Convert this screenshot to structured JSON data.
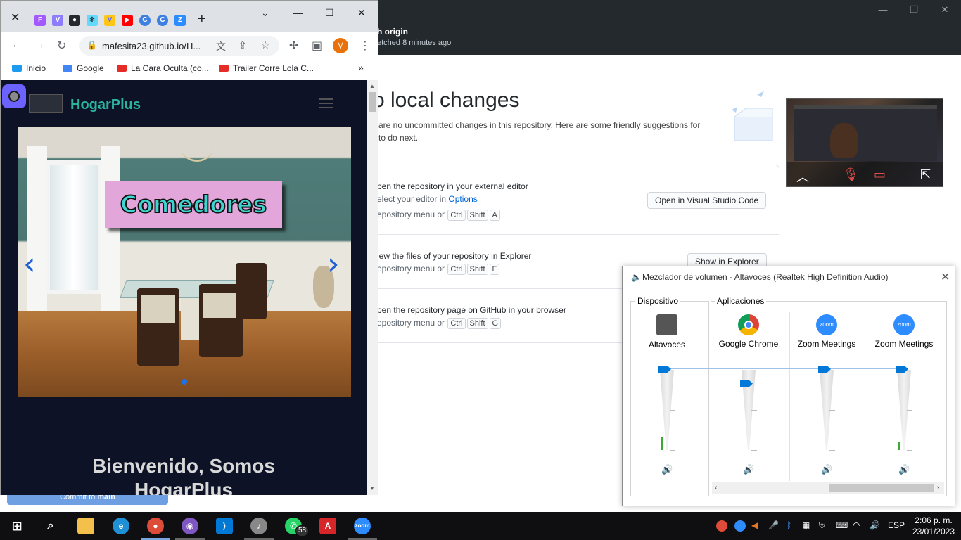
{
  "github": {
    "fetch_title": "h origin",
    "fetch_sub": "etched 8 minutes ago",
    "heading": "o local changes",
    "desc": "are no uncommitted changes in this repository. Here are some friendly suggestions for to do next.",
    "desc_line1": "are no uncommitted changes in this repository. Here are some friendly suggestions for",
    "desc_line2": "to do next.",
    "items": [
      {
        "title": "pen the repository in your external editor",
        "sub_prefix": "elect your editor in ",
        "sub_link": "Options",
        "shortcut_prefix": "epository menu or",
        "keys": [
          "Ctrl",
          "Shift",
          "A"
        ],
        "button": "Open in Visual Studio Code"
      },
      {
        "title": "iew the files of your repository in Explorer",
        "shortcut_prefix": "epository menu or",
        "keys": [
          "Ctrl",
          "Shift",
          "F"
        ],
        "button": "Show in Explorer"
      },
      {
        "title": "pen the repository page on GitHub in your browser",
        "shortcut_prefix": "epository menu or",
        "keys": [
          "Ctrl",
          "Shift",
          "G"
        ]
      }
    ],
    "commit_button": "Commit to main",
    "commit_branch": "main",
    "commit_prefix": "Commit to "
  },
  "chrome": {
    "url": "mafesita23.github.io/H...",
    "profile_initial": "M",
    "bookmarks": [
      {
        "label": "Inicio",
        "color": "#1d9bf0"
      },
      {
        "label": "Google",
        "color": "#4285f4"
      },
      {
        "label": "La Cara Oculta (co...",
        "color": "#e52d27"
      },
      {
        "label": "Trailer Corre Lola C...",
        "color": "#e52d27"
      }
    ],
    "bookmarks_more": "»"
  },
  "site": {
    "brand": "HogarPlus",
    "carousel_caption": "Comedores",
    "welcome_line1": "Bienvenido, Somos",
    "welcome_line2": "HogarPlus"
  },
  "mixer": {
    "title": "Mezclador de volumen - Altavoces (Realtek High Definition Audio)",
    "device_group": "Dispositivo",
    "apps_group": "Aplicaciones",
    "channels": [
      {
        "name": "Altavoces",
        "volume": 1.0,
        "level": 0.16
      },
      {
        "name": "Google Chrome",
        "volume": 0.82,
        "level": 0.0
      },
      {
        "name": "Zoom Meetings",
        "volume": 1.0,
        "level": 0.0
      },
      {
        "name": "Zoom Meetings",
        "volume": 1.0,
        "level": 0.1
      }
    ]
  },
  "taskbar": {
    "whatsapp_badge": "58",
    "language": "ESP",
    "time": "2:06 p. m.",
    "date": "23/01/2023"
  },
  "colors": {
    "github_dark": "#24292e",
    "site_bg": "#0d1226",
    "brand_teal": "#2bb3a0",
    "mixer_accent": "#0078d7"
  }
}
